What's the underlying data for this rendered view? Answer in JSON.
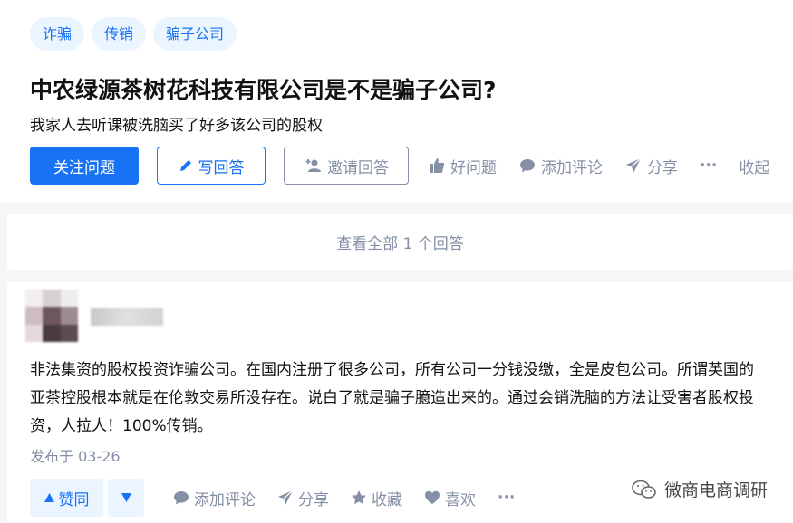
{
  "question": {
    "topics": [
      "诈骗",
      "传销",
      "骗子公司"
    ],
    "title": "中农绿源茶树花科技有限公司是不是骗子公司?",
    "description": "我家人去听课被洗脑买了好多该公司的股权"
  },
  "question_actions": {
    "follow": "关注问题",
    "write": "写回答",
    "invite": "邀请回答",
    "good_question": "好问题",
    "comment": "添加评论",
    "share": "分享",
    "more": "···",
    "collapse": "收起"
  },
  "view_all": "查看全部 1 个回答",
  "answer": {
    "content": "非法集资的股权投资诈骗公司。在国内注册了很多公司，所有公司一分钱没缴，全是皮包公司。所谓英国的亚茶控股根本就是在伦敦交易所没存在。说白了就是骗子臆造出来的。通过会销洗脑的方法让受害者股权投资，人拉人！100%传销。",
    "published": "发布于 03-26",
    "actions": {
      "upvote": "赞同",
      "comment": "添加评论",
      "share": "分享",
      "collect": "收藏",
      "like": "喜欢",
      "more": "···"
    }
  },
  "watermark": "微商电商调研",
  "colors": {
    "accent": "#1772f6",
    "accent_light": "#ebf5ff",
    "muted": "#8590a6",
    "text": "#121212",
    "background": "#f6f6f6"
  },
  "icons": {
    "write": "pencil-icon",
    "invite": "add-user-icon",
    "good_question": "thumbs-up-icon",
    "comment": "comment-bubble-icon",
    "share": "paper-plane-icon",
    "collect": "star-icon",
    "like": "heart-icon",
    "upvote": "triangle-up-icon",
    "downvote": "triangle-down-icon",
    "watermark": "wechat-logo-icon"
  }
}
